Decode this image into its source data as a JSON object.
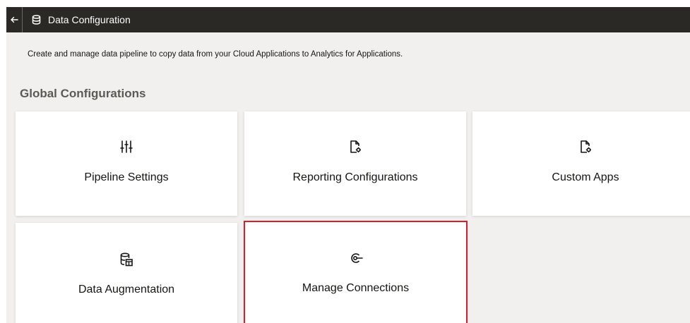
{
  "header": {
    "title": "Data Configuration",
    "back_icon": "arrow-left-icon",
    "title_icon": "database-icon"
  },
  "main": {
    "description": "Create and manage data pipeline to copy data from your Cloud Applications to Analytics for Applications.",
    "section_title": "Global Configurations",
    "tiles": [
      {
        "label": "Pipeline Settings",
        "icon": "sliders-icon"
      },
      {
        "label": "Reporting Configurations",
        "icon": "document-gear-icon"
      },
      {
        "label": "Custom Apps",
        "icon": "document-gear-icon"
      },
      {
        "label": "Data Augmentation",
        "icon": "database-table-icon"
      },
      {
        "label": "Manage Connections",
        "icon": "connection-icon"
      }
    ]
  },
  "colors": {
    "titlebar_bg": "#2b2926",
    "content_bg": "#f1f0ef",
    "selected_outline": "#d2202f"
  }
}
